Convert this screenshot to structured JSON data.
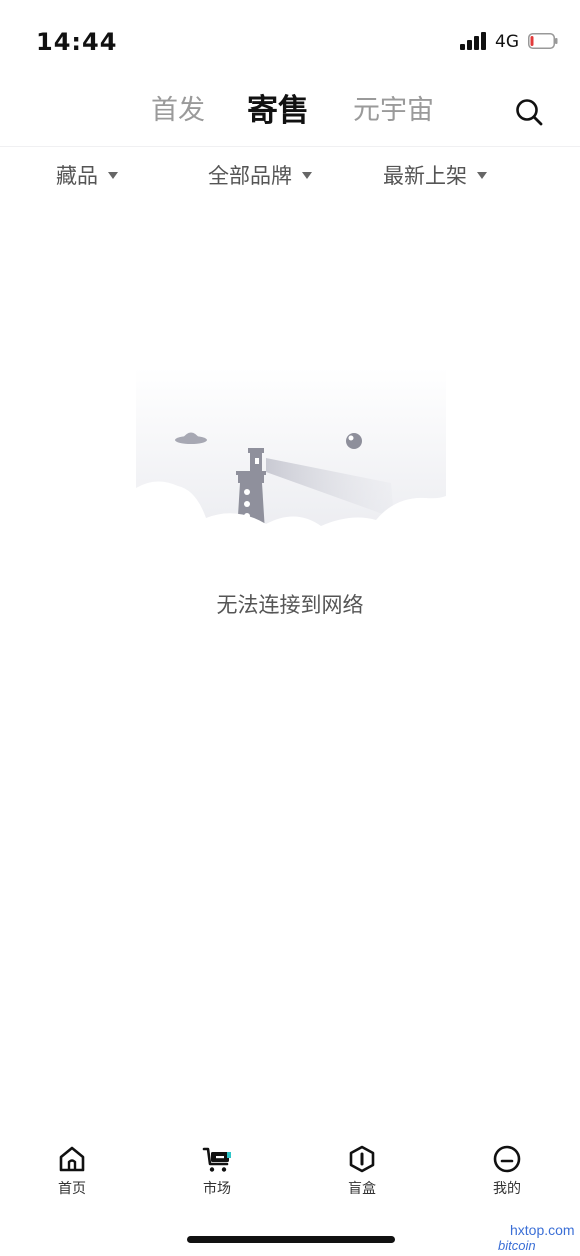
{
  "status_bar": {
    "time": "14:44",
    "network": "4G"
  },
  "header": {
    "tabs": [
      {
        "label": "首发"
      },
      {
        "label": "寄售"
      },
      {
        "label": "元宇宙"
      }
    ],
    "active_tab": "寄售",
    "search_icon": "search-icon"
  },
  "filters": [
    {
      "label": "藏品"
    },
    {
      "label": "全部品牌"
    },
    {
      "label": "最新上架"
    }
  ],
  "empty_state": {
    "message": "无法连接到网络",
    "illustration": "lighthouse-cloud-illustration"
  },
  "bottom_nav": {
    "items": [
      {
        "label": "首页",
        "icon": "home-icon"
      },
      {
        "label": "市场",
        "icon": "cart-icon"
      },
      {
        "label": "盲盒",
        "icon": "blind-box-icon"
      },
      {
        "label": "我的",
        "icon": "profile-icon"
      }
    ],
    "active": "市场"
  },
  "watermark": {
    "site": "hxtop.com",
    "sub": "bitcoin"
  },
  "colors": {
    "accent": "#2ec5c8",
    "active_text": "#111111",
    "inactive_text": "#9a9a9a"
  }
}
